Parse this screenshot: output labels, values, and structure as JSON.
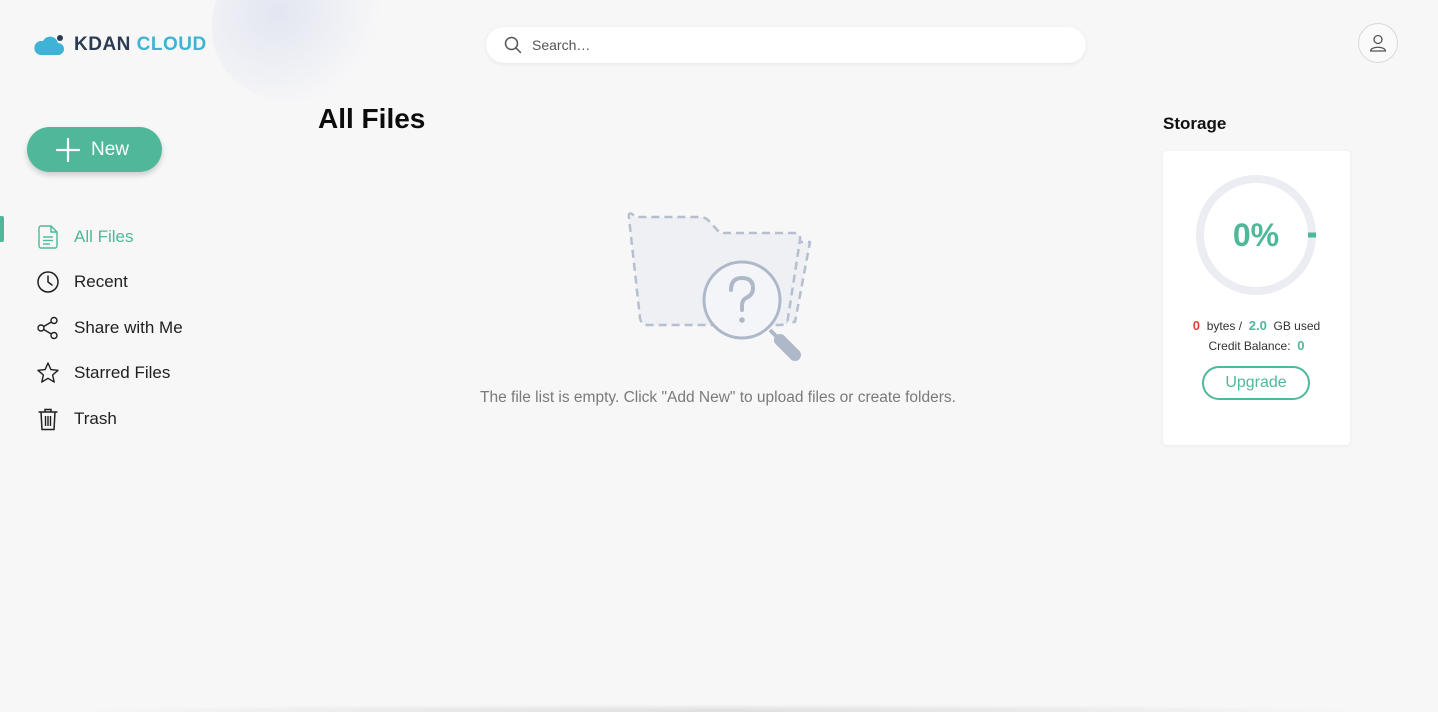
{
  "brand": {
    "name_part1": "KDAN",
    "name_part2": "CLOUD"
  },
  "search": {
    "placeholder": "Search…"
  },
  "new_button": {
    "label": "New"
  },
  "sidebar": {
    "items": [
      {
        "label": "All Files",
        "icon": "document-icon",
        "active": true
      },
      {
        "label": "Recent",
        "icon": "clock-icon",
        "active": false
      },
      {
        "label": "Share with Me",
        "icon": "share-icon",
        "active": false
      },
      {
        "label": "Starred Files",
        "icon": "star-icon",
        "active": false
      },
      {
        "label": "Trash",
        "icon": "trash-icon",
        "active": false
      }
    ]
  },
  "main": {
    "title": "All Files",
    "empty_message": "The file list is empty. Click \"Add New\" to upload files or create folders."
  },
  "storage": {
    "title": "Storage",
    "percent_label": "0%",
    "used_value": "0",
    "used_unit": "bytes /",
    "total_value": "2.0",
    "total_unit": "GB used",
    "credit_label": "Credit Balance:",
    "credit_value": "0",
    "upgrade_label": "Upgrade",
    "used_fraction": 0.0
  },
  "colors": {
    "accent": "#4fb89a",
    "brand_dark": "#2a3b52",
    "brand_light": "#3fb3d6",
    "alert": "#e0453a"
  }
}
